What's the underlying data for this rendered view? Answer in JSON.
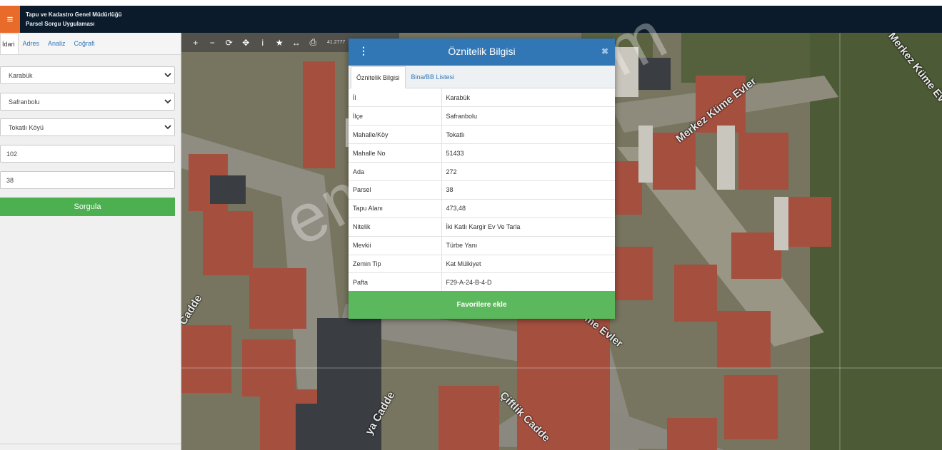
{
  "header": {
    "menu_icon": "hamburger-icon",
    "title_line1": "Tapu ve Kadastro Genel Müdürlüğü",
    "title_line2": "Parsel Sorgu Uygulaması"
  },
  "sidebar": {
    "tabs": [
      {
        "label": "İdari"
      },
      {
        "label": "Adres"
      },
      {
        "label": "Analiz"
      },
      {
        "label": "Coğrafi"
      }
    ],
    "province": "Karabük",
    "district": "Safranbolu",
    "neighborhood": "Tokatlı Köyü",
    "block": "102",
    "parcel": "38",
    "query_button": "Sorgula"
  },
  "map": {
    "toolbar_icons": [
      "zoom-in-icon",
      "zoom-out-icon",
      "refresh-icon",
      "locate-icon",
      "info-icon",
      "bookmark-star-icon",
      "measure-icon",
      "print-icon"
    ],
    "coordinates": "41.2777",
    "road_labels": [
      "Merkez Küme Evler",
      "Merkez Küme Ev",
      "me Evler",
      "Çiftlik Cadde",
      "Cadde",
      "ya Cadde"
    ]
  },
  "watermark": "emlakjet.com",
  "modal": {
    "title": "Öznitelik Bilgisi",
    "tabs": [
      "Öznitelik Bilgisi",
      "Bina/BB Listesi"
    ],
    "rows": [
      {
        "key": "İl",
        "value": "Karabük"
      },
      {
        "key": "İlçe",
        "value": "Safranbolu"
      },
      {
        "key": "Mahalle/Köy",
        "value": "Tokatlı"
      },
      {
        "key": "Mahalle No",
        "value": "51433"
      },
      {
        "key": "Ada",
        "value": "272"
      },
      {
        "key": "Parsel",
        "value": "38"
      },
      {
        "key": "Tapu Alanı",
        "value": "473,48"
      },
      {
        "key": "Nitelik",
        "value": "İki Katlı Kargir Ev Ve Tarla"
      },
      {
        "key": "Mevkii",
        "value": "Türbe Yanı"
      },
      {
        "key": "Zemin Tip",
        "value": "Kat Mülkiyet"
      },
      {
        "key": "Pafta",
        "value": "F29-A-24-B-4-D"
      }
    ],
    "favorite_button": "Favorilere ekle",
    "close_symbol": "✖"
  }
}
